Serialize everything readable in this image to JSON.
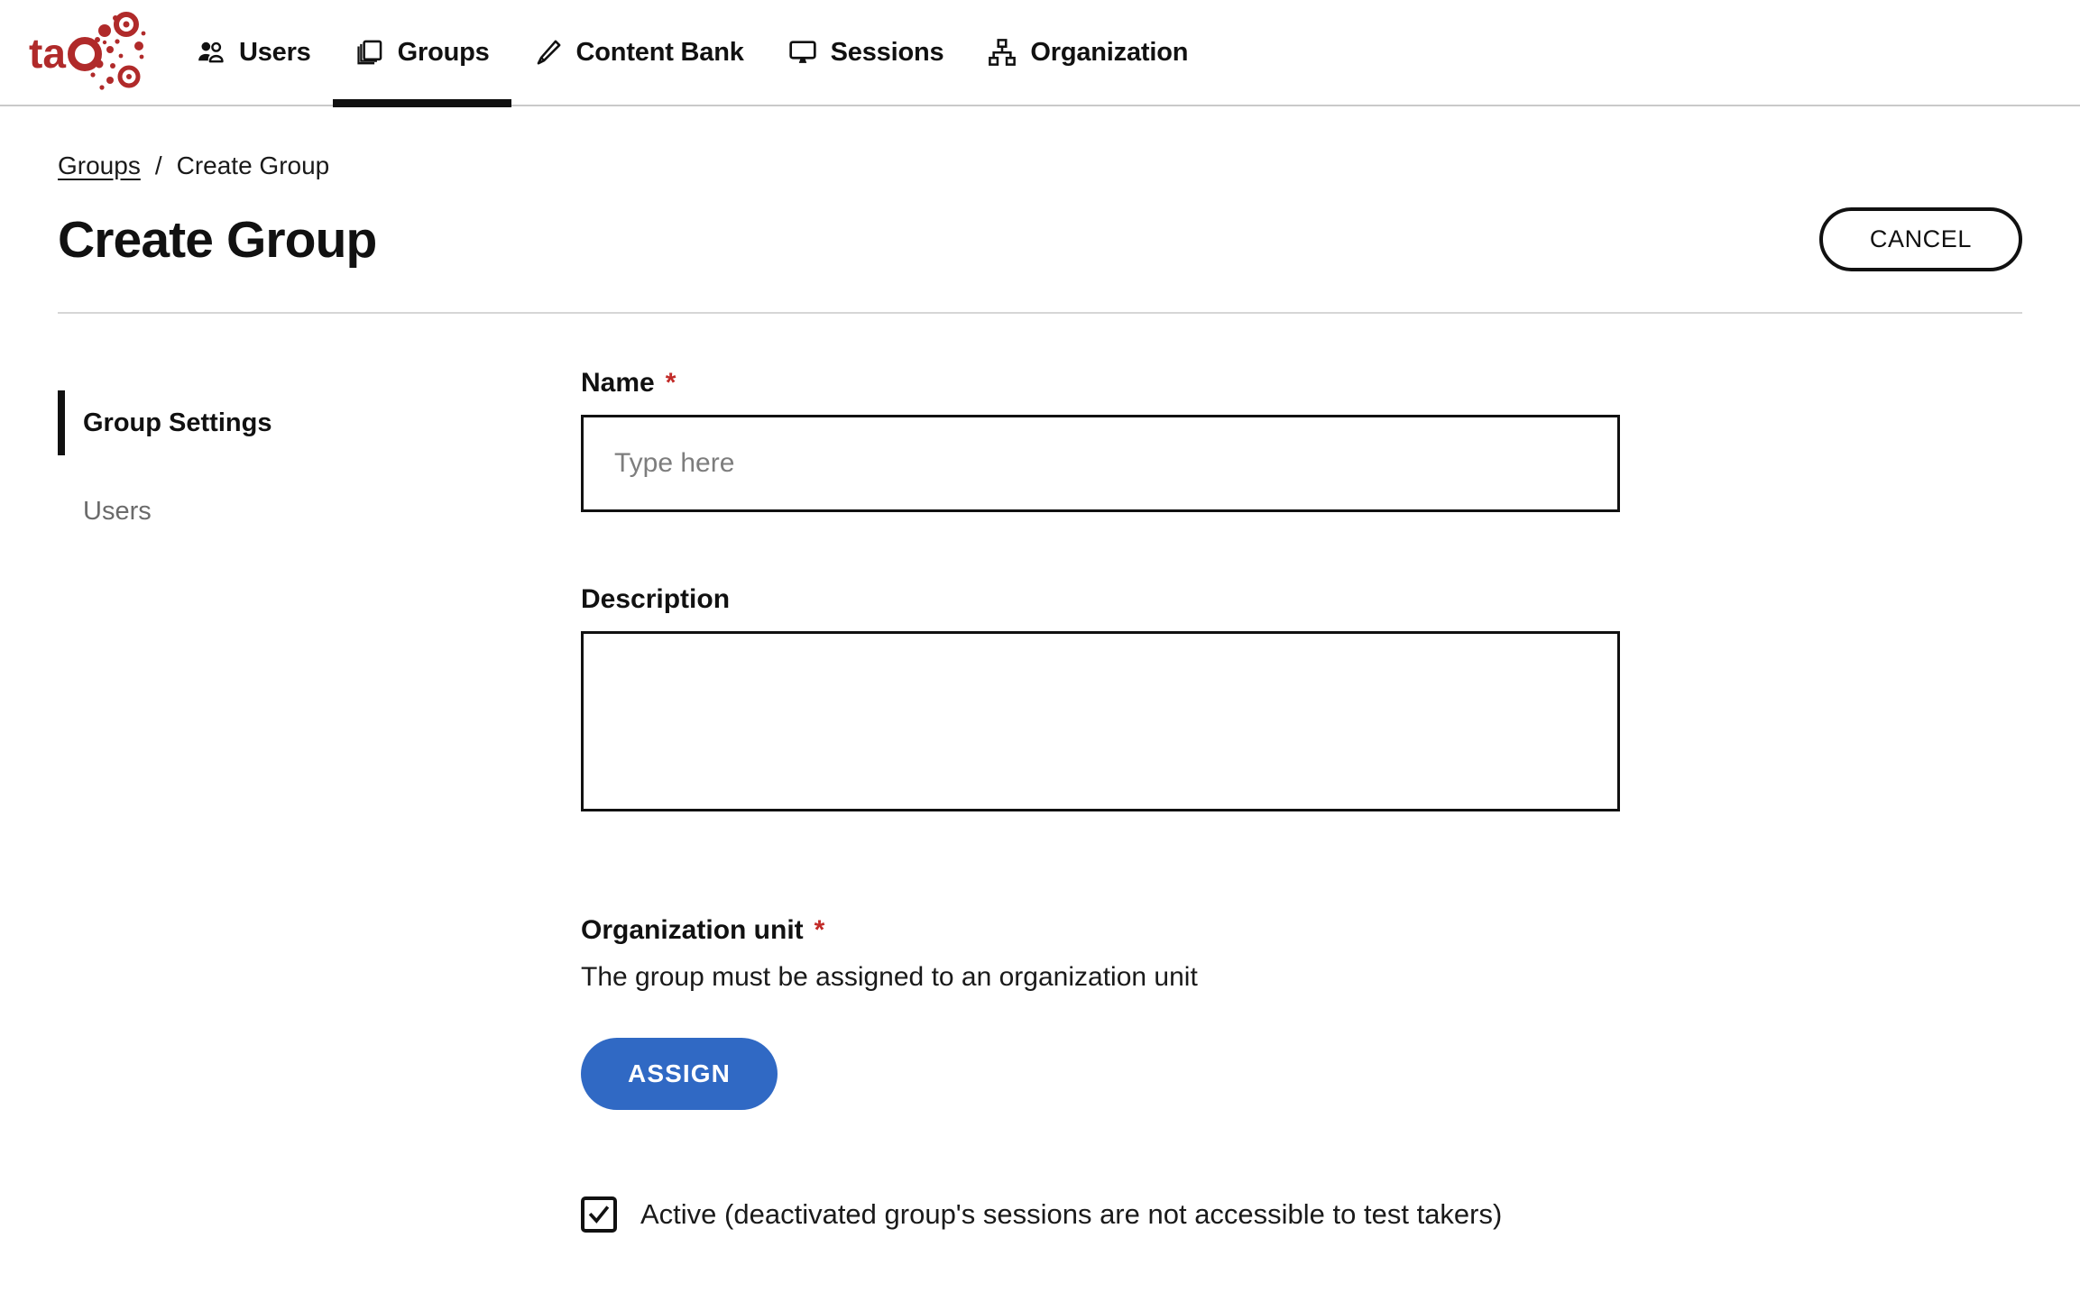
{
  "brand": {
    "logo_text": "tao",
    "logo_color": "#b02a2a"
  },
  "topnav": {
    "items": [
      {
        "label": "Users",
        "icon": "users-icon",
        "active": false
      },
      {
        "label": "Groups",
        "icon": "stacked-squares-icon",
        "active": true
      },
      {
        "label": "Content Bank",
        "icon": "pencil-icon",
        "active": false
      },
      {
        "label": "Sessions",
        "icon": "monitor-icon",
        "active": false
      },
      {
        "label": "Organization",
        "icon": "org-chart-icon",
        "active": false
      }
    ]
  },
  "breadcrumb": {
    "parent": "Groups",
    "separator": "/",
    "current": "Create Group"
  },
  "header": {
    "title": "Create Group",
    "cancel_label": "CANCEL"
  },
  "sidebar": {
    "items": [
      {
        "label": "Group Settings",
        "active": true
      },
      {
        "label": "Users",
        "active": false
      }
    ]
  },
  "form": {
    "name": {
      "label": "Name",
      "required_marker": "*",
      "placeholder": "Type here",
      "value": ""
    },
    "description": {
      "label": "Description",
      "placeholder": "",
      "value": ""
    },
    "organization_unit": {
      "label": "Organization unit",
      "required_marker": "*",
      "helper": "The group must be assigned to an organization unit",
      "assign_label": "ASSIGN",
      "assign_color": "#3069c4"
    },
    "active_checkbox": {
      "label": "Active (deactivated group's sessions are not accessible to test takers)",
      "checked": true
    }
  }
}
